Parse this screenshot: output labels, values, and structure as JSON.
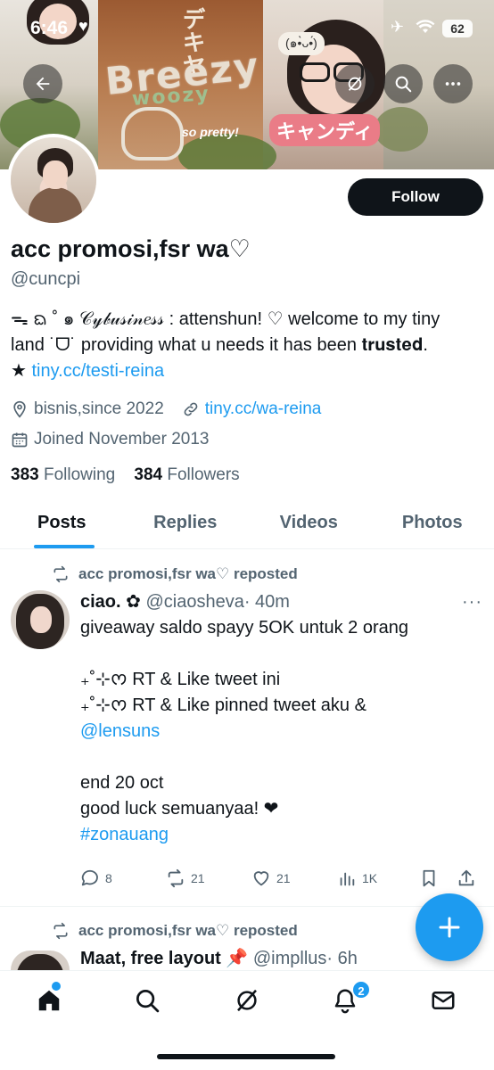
{
  "status_bar": {
    "time": "6:46",
    "battery": "62"
  },
  "banner": {
    "title_big": "Breezy",
    "title_small": "woozy",
    "japanese_top": "デキヤ",
    "japanese_candy": "キャンディ",
    "kaomoji": "(๑•̀ᴗ•́)",
    "caption": "so pretty!"
  },
  "profile": {
    "follow_label": "Follow",
    "display_name": "acc promosi,fsr wa♡",
    "handle": "@cuncpi",
    "bio_line1": "ᯓ ᨳ ˚ ๑ 𝒞𝓎𝒷𝓊𝓈𝒾𝓃𝑒𝓈𝓈 : attenshun! ♡ welcome to my tiny",
    "bio_line2": "land ˙ᗜ˙ providing what u needs it has been 𝐭𝐫𝐮𝐬𝐭𝐞𝐝.",
    "bio_line3_prefix": "★ ",
    "bio_link": "tiny.cc/testi-reina",
    "location": "bisnis,since 2022",
    "website": "tiny.cc/wa-reina",
    "joined": "Joined November 2013",
    "following_count": "383",
    "following_label": "Following",
    "followers_count": "384",
    "followers_label": "Followers"
  },
  "tabs": [
    {
      "label": "Posts",
      "active": true
    },
    {
      "label": "Replies",
      "active": false
    },
    {
      "label": "Videos",
      "active": false
    },
    {
      "label": "Photos",
      "active": false
    }
  ],
  "posts": [
    {
      "repost_label": "acc promosi,fsr wa♡ reposted",
      "author_name": "ciao. ✿",
      "author_handle": "@ciaosheva",
      "time": "· 40m",
      "body_line1": "giveaway saldo spayy 5OK untuk 2 orang",
      "body_line2": "₊˚⊹ᰔ RT & Like tweet ini",
      "body_line3": "₊˚⊹ᰔ RT & Like pinned tweet aku &",
      "mention": "@lensuns",
      "body_line4": "end 20 oct",
      "body_line5": "good luck semuanyaa! ❤",
      "hashtag": "#zonauang",
      "replies": "8",
      "reposts": "21",
      "likes": "21",
      "views": "1K"
    },
    {
      "repost_label": "acc promosi,fsr wa♡ reposted",
      "author_name": "Maat, free layout 📌",
      "author_handle": "@impllus",
      "time": "· 6h"
    }
  ],
  "bottom_nav": {
    "notification_count": "2"
  },
  "colors": {
    "accent": "#1d9bf0",
    "text": "#0f1419",
    "muted": "#536471"
  }
}
